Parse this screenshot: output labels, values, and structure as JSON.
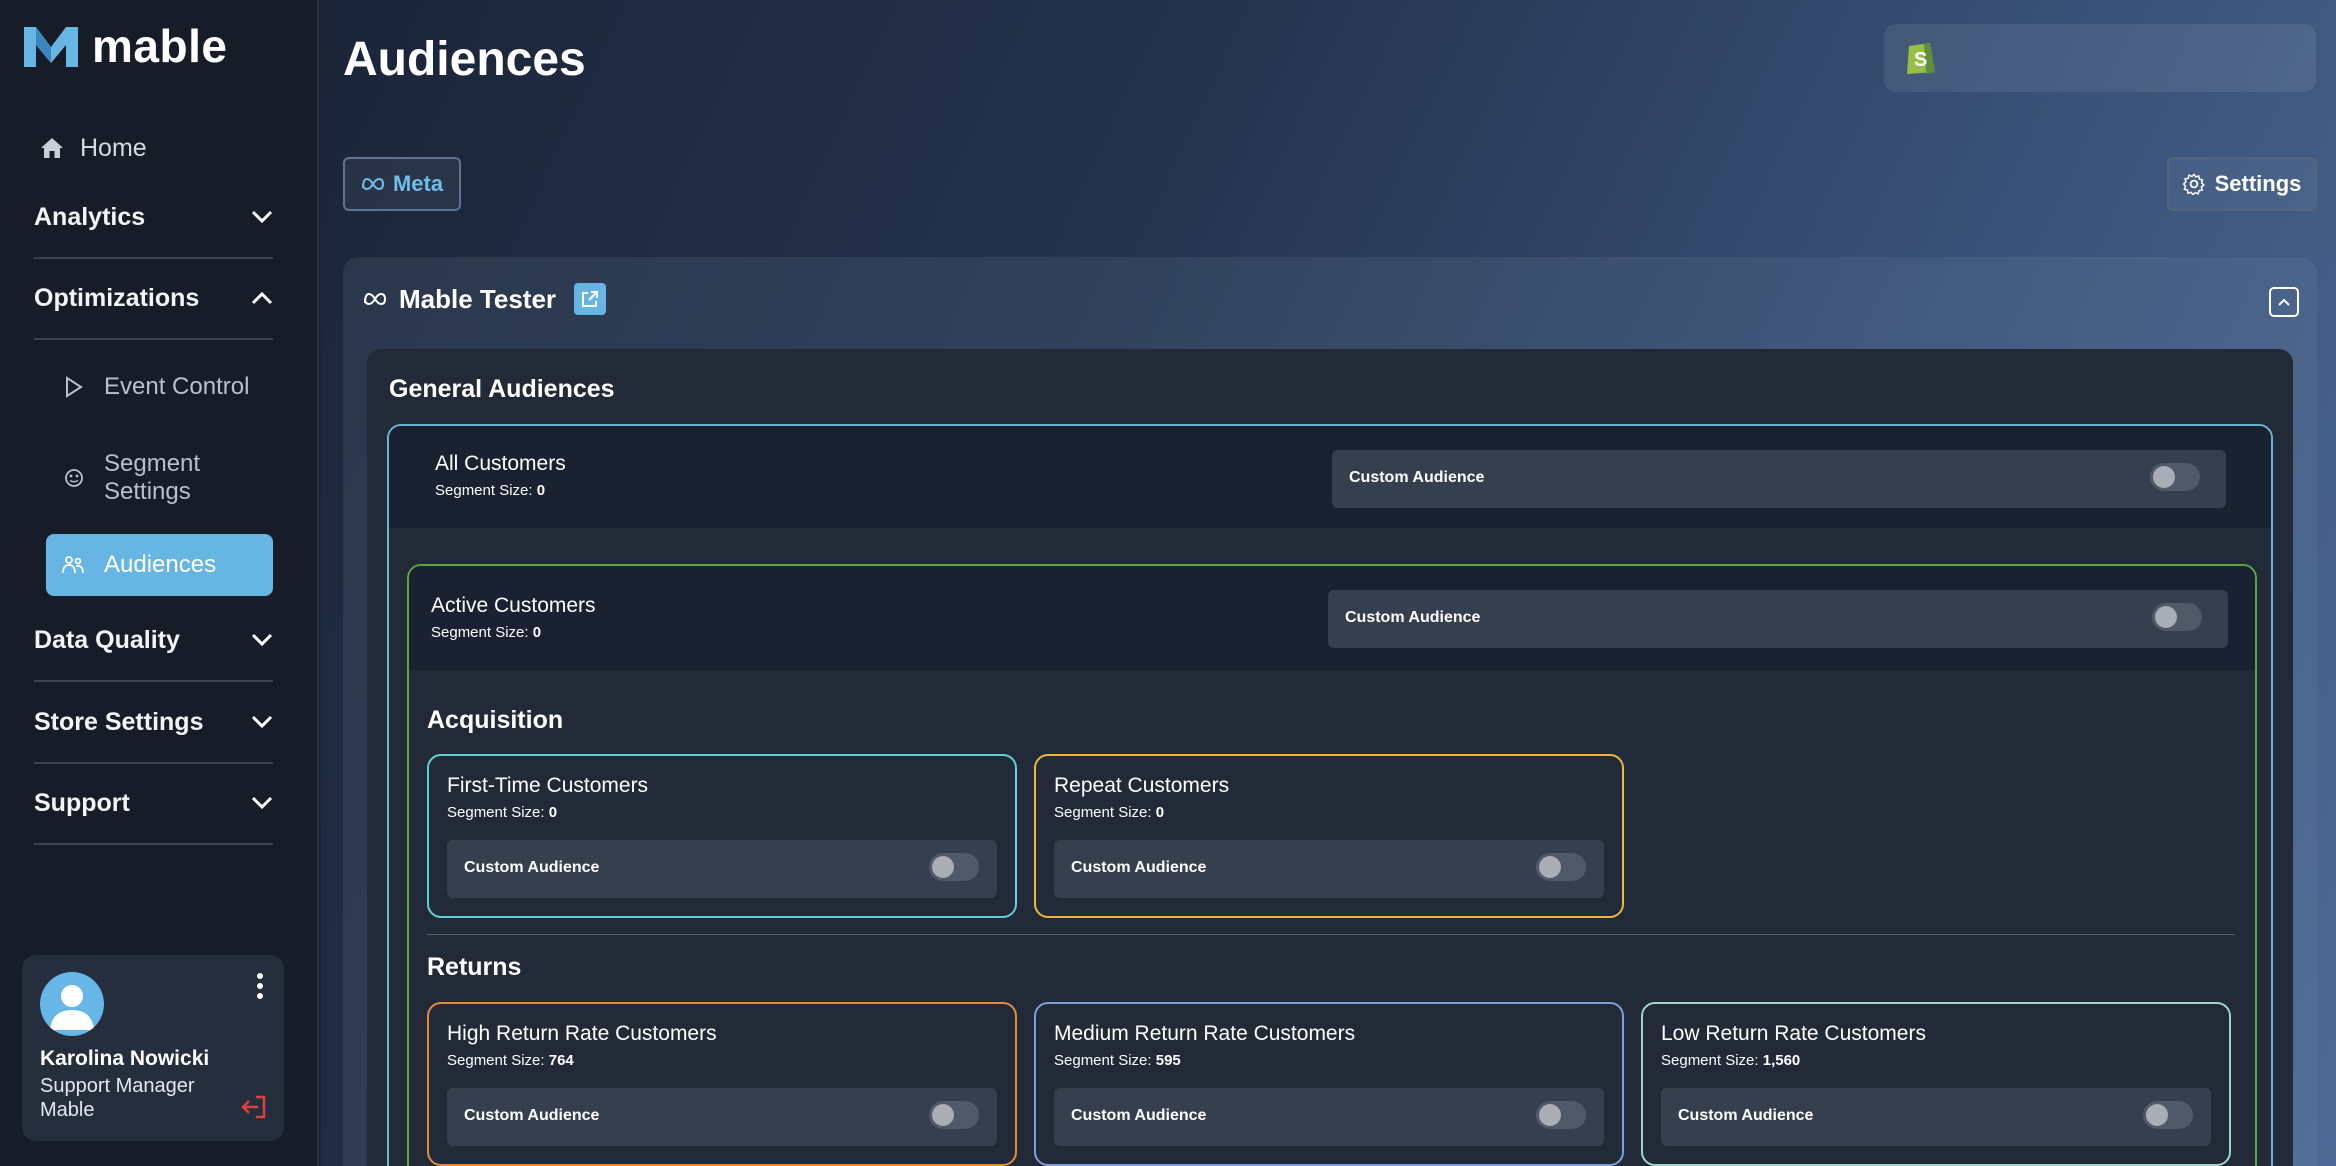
{
  "brand": {
    "name": "mable",
    "accent": "#67b5e3"
  },
  "sidebar": {
    "home": "Home",
    "groups": {
      "analytics": "Analytics",
      "optimizations": "Optimizations",
      "data_quality": "Data Quality",
      "store_settings": "Store Settings",
      "support": "Support"
    },
    "sub_items": {
      "event_control": "Event Control",
      "segment_settings": "Segment Settings",
      "audiences": "Audiences"
    },
    "user": {
      "name": "Karolina Nowicki",
      "role": "Support Manager",
      "org": "Mable"
    }
  },
  "main": {
    "title": "Audiences",
    "platform_tab": "Meta",
    "settings_label": "Settings",
    "account_name": "Mable Tester",
    "general_title": "General Audiences",
    "custom_audience_label": "Custom Audience",
    "segment_size_label": "Segment Size:",
    "all_customers": {
      "name": "All Customers",
      "size": "0"
    },
    "active_customers": {
      "name": "Active Customers",
      "size": "0"
    },
    "acquisition": {
      "title": "Acquisition",
      "first_time": {
        "name": "First-Time Customers",
        "size": "0"
      },
      "repeat": {
        "name": "Repeat Customers",
        "size": "0"
      }
    },
    "returns": {
      "title": "Returns",
      "high": {
        "name": "High Return Rate Customers",
        "size": "764"
      },
      "medium": {
        "name": "Medium Return Rate Customers",
        "size": "595"
      },
      "low": {
        "name": "Low Return Rate Customers",
        "size": "1,560"
      }
    }
  }
}
